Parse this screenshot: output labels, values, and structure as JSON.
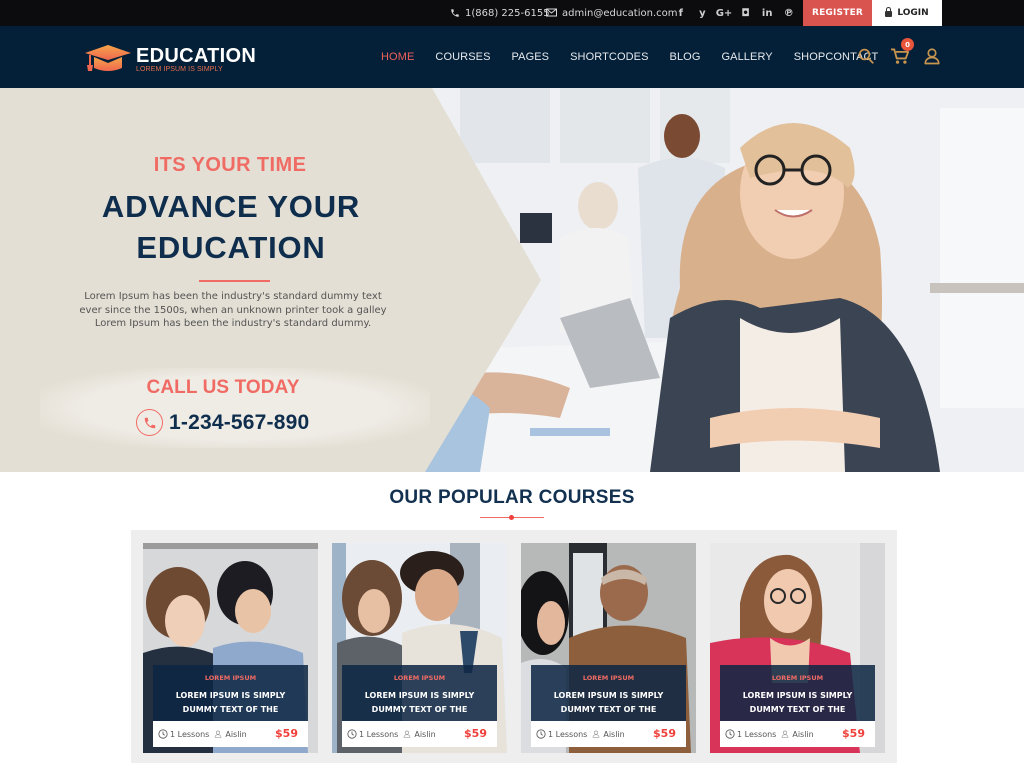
{
  "topbar": {
    "phone": "1(868) 225-6155",
    "email": "admin@education.com",
    "socials": [
      {
        "name": "facebook",
        "glyph": "f"
      },
      {
        "name": "twitter",
        "glyph": "y"
      },
      {
        "name": "google-plus",
        "glyph": "G+"
      },
      {
        "name": "instagram",
        "glyph": "◘"
      },
      {
        "name": "linkedin",
        "glyph": "in"
      },
      {
        "name": "pinterest",
        "glyph": "℗"
      }
    ],
    "register_label": "REGISTER",
    "login_label": "LOGIN"
  },
  "navbar": {
    "brand": "EDUCATION",
    "tagline": "LOREM IPSUM IS SIMPLY",
    "menu": [
      {
        "label": "HOME",
        "active": true
      },
      {
        "label": "COURSES",
        "active": false
      },
      {
        "label": "PAGES",
        "active": false
      },
      {
        "label": "SHORTCODES",
        "active": false
      },
      {
        "label": "BLOG",
        "active": false
      },
      {
        "label": "GALLERY",
        "active": false
      },
      {
        "label": "SHOPCONTACT",
        "active": false
      }
    ],
    "cart_count": "0",
    "icons": [
      "search-icon",
      "cart-icon",
      "user-icon"
    ]
  },
  "hero": {
    "kicker": "ITS YOUR TIME",
    "title_line1": "ADVANCE YOUR",
    "title_line2": "EDUCATION",
    "description": "Lorem Ipsum has been the industry's standard dummy text ever since the 1500s, when an unknown printer took a galley Lorem Ipsum has been the industry's standard dummy.",
    "call_label": "CALL US TODAY",
    "call_number": "1-234-567-890"
  },
  "courses": {
    "heading": "OUR POPULAR COURSES",
    "items": [
      {
        "category": "LOREM IPSUM",
        "title_line1": "LOREM IPSUM IS SIMPLY",
        "title_line2": "DUMMY TEXT OF THE",
        "lessons": "1 Lessons",
        "author": "Aislin",
        "price": "$59"
      },
      {
        "category": "LOREM IPSUM",
        "title_line1": "LOREM IPSUM IS SIMPLY",
        "title_line2": "DUMMY TEXT OF THE",
        "lessons": "1 Lessons",
        "author": "Aislin",
        "price": "$59"
      },
      {
        "category": "LOREM IPSUM",
        "title_line1": "LOREM IPSUM IS SIMPLY",
        "title_line2": "DUMMY TEXT OF THE",
        "lessons": "1 Lessons",
        "author": "Aislin",
        "price": "$59"
      },
      {
        "category": "LOREM IPSUM",
        "title_line1": "LOREM IPSUM IS SIMPLY",
        "title_line2": "DUMMY TEXT OF THE",
        "lessons": "1 Lessons",
        "author": "Aislin",
        "price": "$59"
      }
    ]
  },
  "colors": {
    "topbar_bg": "#0c0b0d",
    "navbar_bg": "#032038",
    "accent_red": "#f06b64",
    "register_bg": "#d9534f",
    "navy_text": "#0f2d4c",
    "hero_panel": "#e3dfd4",
    "icon_gold": "#c8954f"
  }
}
